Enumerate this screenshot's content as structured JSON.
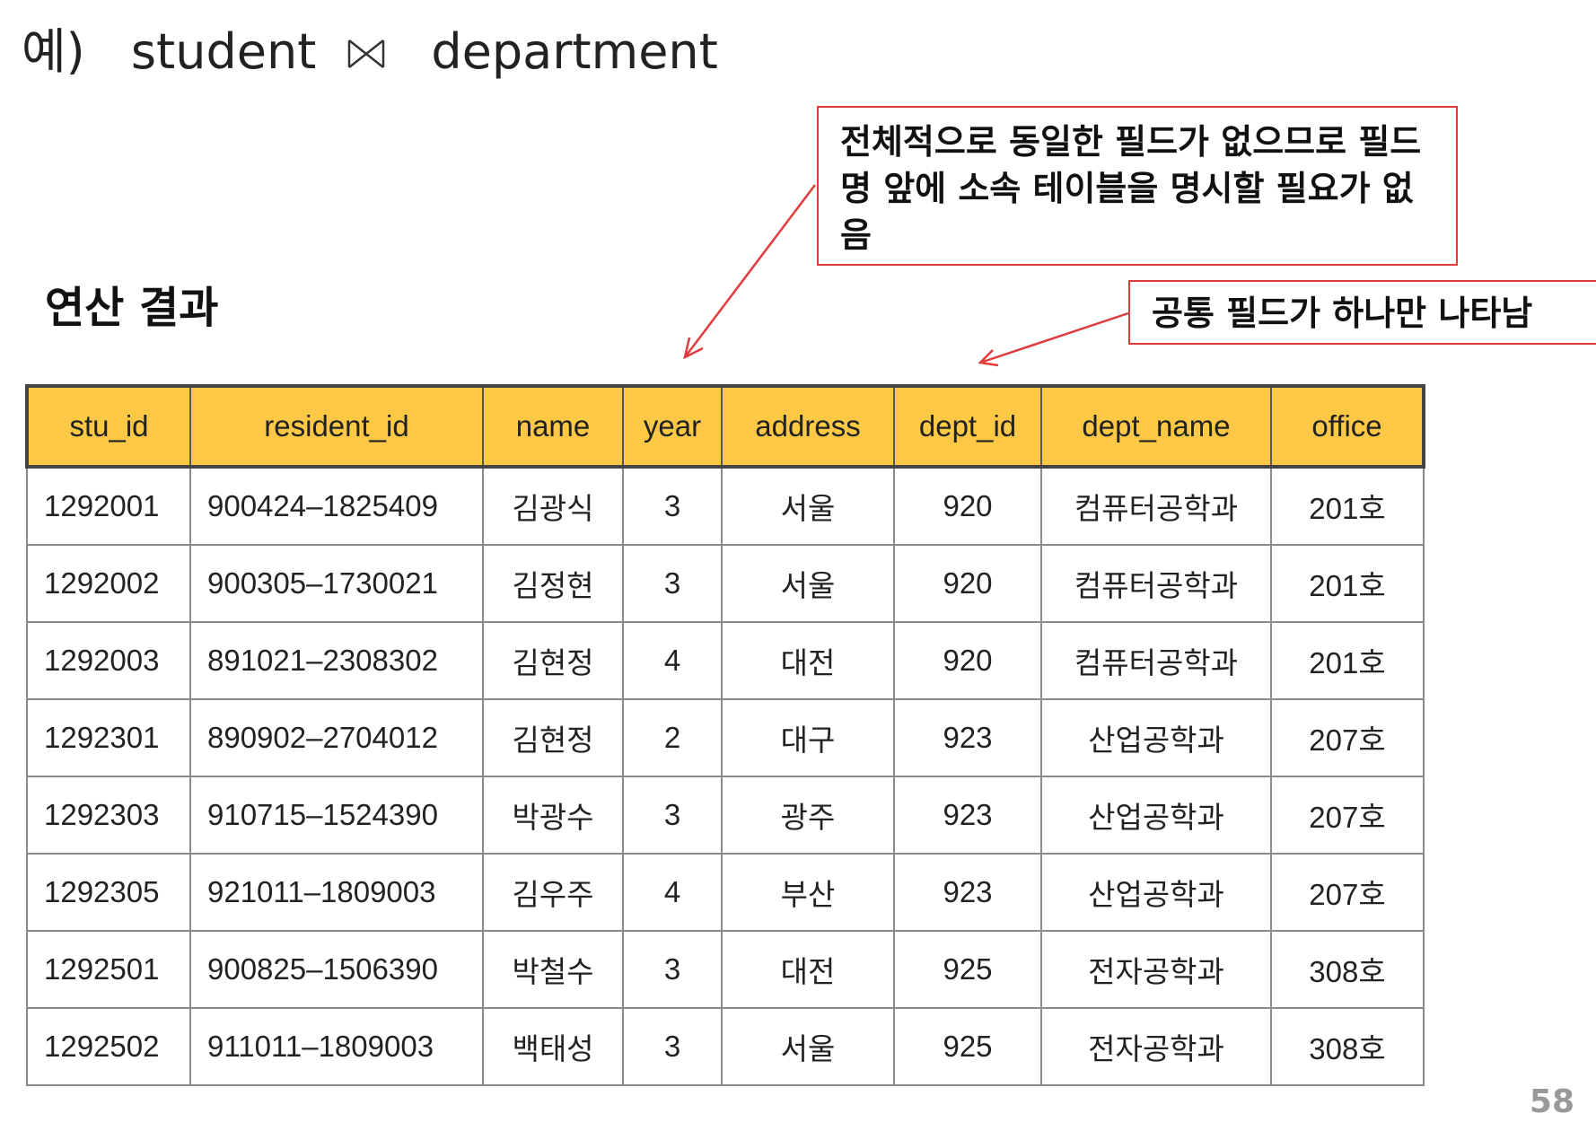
{
  "title": {
    "prefix": "예)",
    "left_relation": "student",
    "right_relation": "department",
    "operator_icon": "natural-join-icon"
  },
  "section_label": "연산 결과",
  "callouts": {
    "fields_note": "전체적으로 동일한 필드가 없으므로 필드명 앞에 소속 테이블을 명시할 필요가 없음",
    "common_field_note": "공통 필드가 하나만 나타남"
  },
  "colors": {
    "header_fill": "#fcc845",
    "callout_border": "#e23b3b"
  },
  "table": {
    "columns": [
      "stu_id",
      "resident_id",
      "name",
      "year",
      "address",
      "dept_id",
      "dept_name",
      "office"
    ],
    "rows": [
      [
        "1292001",
        "900424–1825409",
        "김광식",
        "3",
        "서울",
        "920",
        "컴퓨터공학과",
        "201호"
      ],
      [
        "1292002",
        "900305–1730021",
        "김정현",
        "3",
        "서울",
        "920",
        "컴퓨터공학과",
        "201호"
      ],
      [
        "1292003",
        "891021–2308302",
        "김현정",
        "4",
        "대전",
        "920",
        "컴퓨터공학과",
        "201호"
      ],
      [
        "1292301",
        "890902–2704012",
        "김현정",
        "2",
        "대구",
        "923",
        "산업공학과",
        "207호"
      ],
      [
        "1292303",
        "910715–1524390",
        "박광수",
        "3",
        "광주",
        "923",
        "산업공학과",
        "207호"
      ],
      [
        "1292305",
        "921011–1809003",
        "김우주",
        "4",
        "부산",
        "923",
        "산업공학과",
        "207호"
      ],
      [
        "1292501",
        "900825–1506390",
        "박철수",
        "3",
        "대전",
        "925",
        "전자공학과",
        "308호"
      ],
      [
        "1292502",
        "911011–1809003",
        "백태성",
        "3",
        "서울",
        "925",
        "전자공학과",
        "308호"
      ]
    ]
  },
  "page_number": "58"
}
